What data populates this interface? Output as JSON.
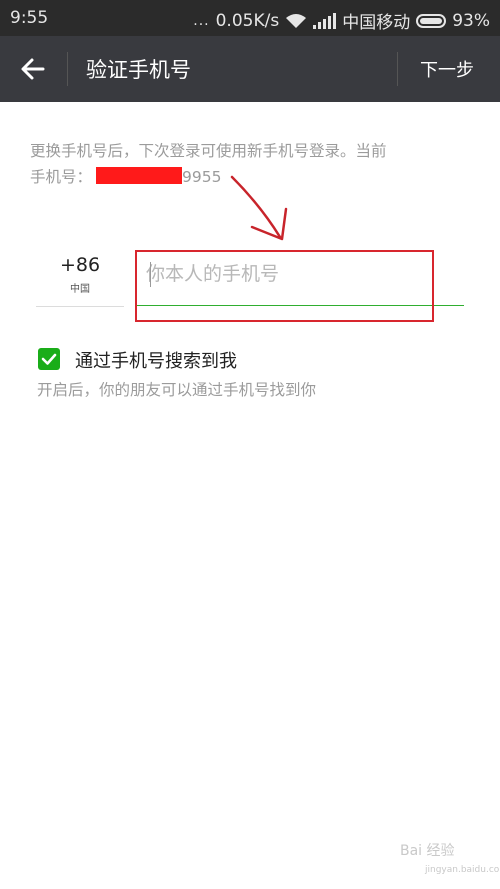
{
  "status_bar": {
    "time": "9:55",
    "dots": "...",
    "speed": "0.05K/s",
    "carrier": "中国移动",
    "battery": "93%"
  },
  "nav": {
    "back_icon": "arrow-left-icon",
    "title": "验证手机号",
    "next_label": "下一步"
  },
  "description": {
    "line1": "更换手机号后，下次登录可使用新手机号登录。当前",
    "prefix": "手机号：",
    "suffix": "9955"
  },
  "country_code": {
    "code": "+86",
    "country": "中国"
  },
  "phone_input": {
    "placeholder": "你本人的手机号",
    "value": ""
  },
  "search_option": {
    "checked": true,
    "label": "通过手机号搜索到我",
    "hint": "开启后，你的朋友可以通过手机号找到你"
  },
  "watermark": {
    "text": "Bai 经验",
    "url": "jingyan.baidu.com"
  },
  "colors": {
    "status_bar": "#2b2b2b",
    "nav_bar": "#393a3f",
    "accent_green": "#1aad19",
    "annotation_red": "#d8262e"
  }
}
